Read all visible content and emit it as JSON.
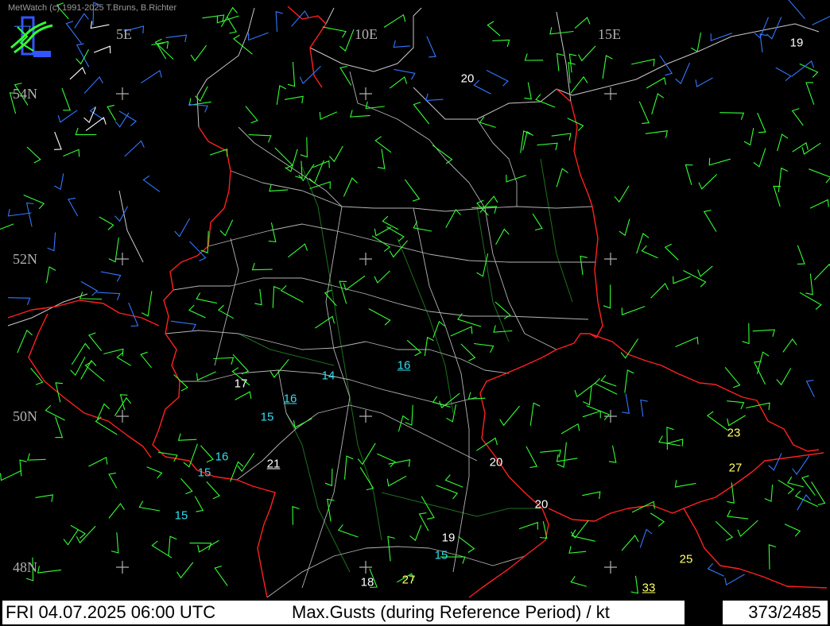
{
  "header": {
    "copyright": "MetWatch  (c) 1991-2025 T.Bruns, B.Richter"
  },
  "colors": {
    "background": "#000000",
    "border": "#ff2020",
    "admin": "#b4b4b4",
    "river": "#1f6f1f",
    "wind_green": "#33ff33",
    "wind_blue": "#3377ff",
    "wind_white": "#ffffff",
    "gust_cyan": "#33ddee",
    "gust_white": "#ffffff",
    "gust_yellow": "#ffff66"
  },
  "grid_labels": {
    "lon_5": "5E",
    "lon_10": "10E",
    "lon_15": "15E",
    "lat_54": "54N",
    "lat_52": "52N",
    "lat_50": "50N",
    "lat_48": "48N"
  },
  "gusts": [
    {
      "value": "19",
      "color": "white",
      "underline": false
    },
    {
      "value": "20",
      "color": "white",
      "underline": false
    },
    {
      "value": "16",
      "color": "cyan",
      "underline": true
    },
    {
      "value": "14",
      "color": "cyan",
      "underline": false
    },
    {
      "value": "17",
      "color": "white",
      "underline": false
    },
    {
      "value": "16",
      "color": "cyan",
      "underline": true
    },
    {
      "value": "15",
      "color": "cyan",
      "underline": false
    },
    {
      "value": "16",
      "color": "cyan",
      "underline": false
    },
    {
      "value": "21",
      "color": "white",
      "underline": true
    },
    {
      "value": "15",
      "color": "cyan",
      "underline": false
    },
    {
      "value": "15",
      "color": "cyan",
      "underline": false
    },
    {
      "value": "20",
      "color": "white",
      "underline": false
    },
    {
      "value": "20",
      "color": "white",
      "underline": false
    },
    {
      "value": "23",
      "color": "yellow",
      "underline": false
    },
    {
      "value": "27",
      "color": "yellow",
      "underline": false
    },
    {
      "value": "19",
      "color": "white",
      "underline": false
    },
    {
      "value": "15",
      "color": "cyan",
      "underline": false
    },
    {
      "value": "25",
      "color": "yellow",
      "underline": false
    },
    {
      "value": "18",
      "color": "white",
      "underline": false
    },
    {
      "value": "27",
      "color": "yellow",
      "underline": false
    },
    {
      "value": "33",
      "color": "yellow",
      "underline": true
    }
  ],
  "status": {
    "datetime": "FRI 04.07.2025 06:00 UTC",
    "parameter": "Max.Gusts (during Reference Period) / kt",
    "count": "373/2485"
  }
}
